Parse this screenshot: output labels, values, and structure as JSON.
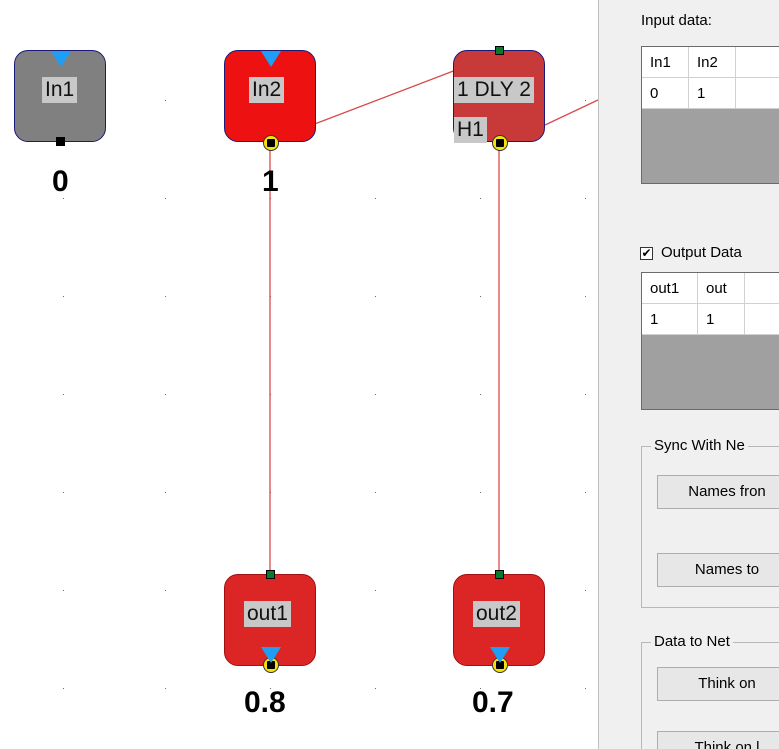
{
  "canvas": {
    "nodes": {
      "in1": {
        "label": "In1",
        "value": "0"
      },
      "in2": {
        "label": "In2",
        "value": "1"
      },
      "dly": {
        "label_line1": "1 DLY 2",
        "label_line2": "H1"
      },
      "out1": {
        "label": "out1",
        "value": "0.8"
      },
      "out2": {
        "label": "out2",
        "value": "0.7"
      }
    }
  },
  "panel": {
    "input_title": "Input data:",
    "input_columns": [
      "In1",
      "In2"
    ],
    "input_rows": [
      [
        "0",
        "1"
      ]
    ],
    "output_checkbox_label": "Output Data",
    "output_checked": true,
    "output_columns": [
      "out1",
      "out"
    ],
    "output_rows": [
      [
        "1",
        "1"
      ]
    ],
    "sync_group_title": "Sync With Ne",
    "names_from_button": "Names fron",
    "names_to_button": "Names to",
    "data_to_net_title": "Data to Net",
    "think_on_button": "Think on",
    "think_on_2_button": "Think on l"
  },
  "colors": {
    "node_red": "#ee1111",
    "node_gray": "#808080",
    "node_dark_red": "#c83a3a",
    "wire": "#d94a4a",
    "port_blue": "#1e9ff5",
    "port_yellow": "#f7e10c"
  }
}
